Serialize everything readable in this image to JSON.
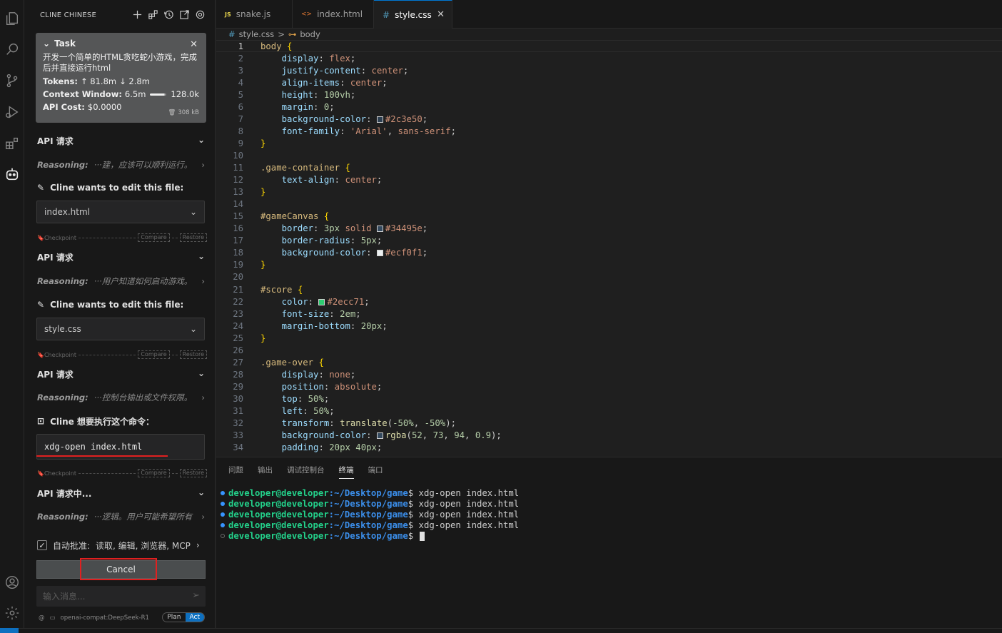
{
  "sidebar": {
    "title": "CLINE CHINESE",
    "task": {
      "label": "Task",
      "description": "开发一个简单的HTML贪吃蛇小游戏，完成后并直接运行html",
      "tokens_label": "Tokens:",
      "tokens_in": "↑ 81.8m",
      "tokens_out": "↓ 2.8m",
      "context_label": "Context Window:",
      "context_used": "6.5m",
      "context_max": "128.0k",
      "context_fill": 0.9,
      "cost_label": "API Cost:",
      "cost_value": "$0.0000",
      "size": "308 kB"
    },
    "messages": [
      {
        "api_label": "API 请求",
        "reason_label": "Reasoning:",
        "reason_text": "···建，应该可以顺利运行。",
        "edit_label": "Cline wants to edit this file:",
        "file": "index.html"
      },
      {
        "api_label": "API 请求",
        "reason_label": "Reasoning:",
        "reason_text": "···用户知道如何启动游戏。",
        "edit_label": "Cline wants to edit this file:",
        "file": "style.css"
      },
      {
        "api_label": "API 请求",
        "reason_label": "Reasoning:",
        "reason_text": "···控制台输出或文件权限。",
        "cmd_label": "Cline 想要执行这个命令：",
        "command": "xdg-open index.html"
      },
      {
        "api_label": "API 请求中...",
        "reason_label": "Reasoning:",
        "reason_text": "···逻辑。用户可能希望所有"
      }
    ],
    "checkpoint": {
      "label": "Checkpoint",
      "compare": "Compare",
      "restore": "Restore"
    },
    "auto_approve": {
      "label": "自动批准:",
      "items": "读取, 编辑, 浏览器, MCP"
    },
    "cancel_label": "Cancel",
    "input_placeholder": "输入消息...",
    "model": "openai-compat:DeepSeek-R1",
    "mode_plan": "Plan",
    "mode_act": "Act"
  },
  "tabs": [
    {
      "icon": "JS",
      "label": "snake.js"
    },
    {
      "icon": "<>",
      "label": "index.html"
    },
    {
      "icon": "#",
      "label": "style.css"
    }
  ],
  "breadcrumb": {
    "file_icon": "#",
    "file": "style.css",
    "separator": ">",
    "symbol": "body"
  },
  "editor": {
    "lines": [
      [
        [
          "c-sel",
          "body"
        ],
        [
          "c-pun",
          " "
        ],
        [
          "c-brace",
          "{"
        ]
      ],
      [
        [
          "c-pun",
          "    "
        ],
        [
          "c-prop",
          "display"
        ],
        [
          "c-pun",
          ": "
        ],
        [
          "c-val",
          "flex"
        ],
        [
          "c-pun",
          ";"
        ]
      ],
      [
        [
          "c-pun",
          "    "
        ],
        [
          "c-prop",
          "justify-content"
        ],
        [
          "c-pun",
          ": "
        ],
        [
          "c-val",
          "center"
        ],
        [
          "c-pun",
          ";"
        ]
      ],
      [
        [
          "c-pun",
          "    "
        ],
        [
          "c-prop",
          "align-items"
        ],
        [
          "c-pun",
          ": "
        ],
        [
          "c-val",
          "center"
        ],
        [
          "c-pun",
          ";"
        ]
      ],
      [
        [
          "c-pun",
          "    "
        ],
        [
          "c-prop",
          "height"
        ],
        [
          "c-pun",
          ": "
        ],
        [
          "c-num",
          "100vh"
        ],
        [
          "c-pun",
          ";"
        ]
      ],
      [
        [
          "c-pun",
          "    "
        ],
        [
          "c-prop",
          "margin"
        ],
        [
          "c-pun",
          ": "
        ],
        [
          "c-num",
          "0"
        ],
        [
          "c-pun",
          ";"
        ]
      ],
      [
        [
          "c-pun",
          "    "
        ],
        [
          "c-prop",
          "background-color"
        ],
        [
          "c-pun",
          ": "
        ],
        [
          "swatch",
          "#2c3e50"
        ],
        [
          "c-val",
          "#2c3e50"
        ],
        [
          "c-pun",
          ";"
        ]
      ],
      [
        [
          "c-pun",
          "    "
        ],
        [
          "c-prop",
          "font-family"
        ],
        [
          "c-pun",
          ": "
        ],
        [
          "c-val",
          "'Arial'"
        ],
        [
          "c-pun",
          ", "
        ],
        [
          "c-val",
          "sans-serif"
        ],
        [
          "c-pun",
          ";"
        ]
      ],
      [
        [
          "c-brace",
          "}"
        ]
      ],
      [],
      [
        [
          "c-sel",
          ".game-container"
        ],
        [
          "c-pun",
          " "
        ],
        [
          "c-brace",
          "{"
        ]
      ],
      [
        [
          "c-pun",
          "    "
        ],
        [
          "c-prop",
          "text-align"
        ],
        [
          "c-pun",
          ": "
        ],
        [
          "c-val",
          "center"
        ],
        [
          "c-pun",
          ";"
        ]
      ],
      [
        [
          "c-brace",
          "}"
        ]
      ],
      [],
      [
        [
          "c-sel",
          "#gameCanvas"
        ],
        [
          "c-pun",
          " "
        ],
        [
          "c-brace",
          "{"
        ]
      ],
      [
        [
          "c-pun",
          "    "
        ],
        [
          "c-prop",
          "border"
        ],
        [
          "c-pun",
          ": "
        ],
        [
          "c-num",
          "3px"
        ],
        [
          "c-pun",
          " "
        ],
        [
          "c-val",
          "solid"
        ],
        [
          "c-pun",
          " "
        ],
        [
          "swatch",
          "#34495e"
        ],
        [
          "c-val",
          "#34495e"
        ],
        [
          "c-pun",
          ";"
        ]
      ],
      [
        [
          "c-pun",
          "    "
        ],
        [
          "c-prop",
          "border-radius"
        ],
        [
          "c-pun",
          ": "
        ],
        [
          "c-num",
          "5px"
        ],
        [
          "c-pun",
          ";"
        ]
      ],
      [
        [
          "c-pun",
          "    "
        ],
        [
          "c-prop",
          "background-color"
        ],
        [
          "c-pun",
          ": "
        ],
        [
          "swatch",
          "#ecf0f1"
        ],
        [
          "c-val",
          "#ecf0f1"
        ],
        [
          "c-pun",
          ";"
        ]
      ],
      [
        [
          "c-brace",
          "}"
        ]
      ],
      [],
      [
        [
          "c-sel",
          "#score"
        ],
        [
          "c-pun",
          " "
        ],
        [
          "c-brace",
          "{"
        ]
      ],
      [
        [
          "c-pun",
          "    "
        ],
        [
          "c-prop",
          "color"
        ],
        [
          "c-pun",
          ": "
        ],
        [
          "swatch",
          "#2ecc71"
        ],
        [
          "c-val",
          "#2ecc71"
        ],
        [
          "c-pun",
          ";"
        ]
      ],
      [
        [
          "c-pun",
          "    "
        ],
        [
          "c-prop",
          "font-size"
        ],
        [
          "c-pun",
          ": "
        ],
        [
          "c-num",
          "2em"
        ],
        [
          "c-pun",
          ";"
        ]
      ],
      [
        [
          "c-pun",
          "    "
        ],
        [
          "c-prop",
          "margin-bottom"
        ],
        [
          "c-pun",
          ": "
        ],
        [
          "c-num",
          "20px"
        ],
        [
          "c-pun",
          ";"
        ]
      ],
      [
        [
          "c-brace",
          "}"
        ]
      ],
      [],
      [
        [
          "c-sel",
          ".game-over"
        ],
        [
          "c-pun",
          " "
        ],
        [
          "c-brace",
          "{"
        ]
      ],
      [
        [
          "c-pun",
          "    "
        ],
        [
          "c-prop",
          "display"
        ],
        [
          "c-pun",
          ": "
        ],
        [
          "c-val",
          "none"
        ],
        [
          "c-pun",
          ";"
        ]
      ],
      [
        [
          "c-pun",
          "    "
        ],
        [
          "c-prop",
          "position"
        ],
        [
          "c-pun",
          ": "
        ],
        [
          "c-val",
          "absolute"
        ],
        [
          "c-pun",
          ";"
        ]
      ],
      [
        [
          "c-pun",
          "    "
        ],
        [
          "c-prop",
          "top"
        ],
        [
          "c-pun",
          ": "
        ],
        [
          "c-num",
          "50%"
        ],
        [
          "c-pun",
          ";"
        ]
      ],
      [
        [
          "c-pun",
          "    "
        ],
        [
          "c-prop",
          "left"
        ],
        [
          "c-pun",
          ": "
        ],
        [
          "c-num",
          "50%"
        ],
        [
          "c-pun",
          ";"
        ]
      ],
      [
        [
          "c-pun",
          "    "
        ],
        [
          "c-prop",
          "transform"
        ],
        [
          "c-pun",
          ": "
        ],
        [
          "c-fn",
          "translate"
        ],
        [
          "c-pun",
          "("
        ],
        [
          "c-num",
          "-50%"
        ],
        [
          "c-pun",
          ", "
        ],
        [
          "c-num",
          "-50%"
        ],
        [
          "c-pun",
          ");"
        ]
      ],
      [
        [
          "c-pun",
          "    "
        ],
        [
          "c-prop",
          "background-color"
        ],
        [
          "c-pun",
          ": "
        ],
        [
          "swatch",
          "#34495e"
        ],
        [
          "c-fn",
          "rgba"
        ],
        [
          "c-pun",
          "("
        ],
        [
          "c-num",
          "52"
        ],
        [
          "c-pun",
          ", "
        ],
        [
          "c-num",
          "73"
        ],
        [
          "c-pun",
          ", "
        ],
        [
          "c-num",
          "94"
        ],
        [
          "c-pun",
          ", "
        ],
        [
          "c-num",
          "0.9"
        ],
        [
          "c-pun",
          ");"
        ]
      ],
      [
        [
          "c-pun",
          "    "
        ],
        [
          "c-prop",
          "padding"
        ],
        [
          "c-pun",
          ": "
        ],
        [
          "c-num",
          "20px"
        ],
        [
          "c-pun",
          " "
        ],
        [
          "c-num",
          "40px"
        ],
        [
          "c-pun",
          ";"
        ]
      ]
    ]
  },
  "panel": {
    "tabs": [
      "问题",
      "输出",
      "调试控制台",
      "终端",
      "端口"
    ],
    "active_tab": "终端",
    "terminal": {
      "user": "developer@developer",
      "path": ":~/Desktop/game",
      "prompt_end": "$ ",
      "commands": [
        "xdg-open index.html",
        "xdg-open index.html",
        "xdg-open index.html",
        "xdg-open index.html"
      ]
    }
  }
}
